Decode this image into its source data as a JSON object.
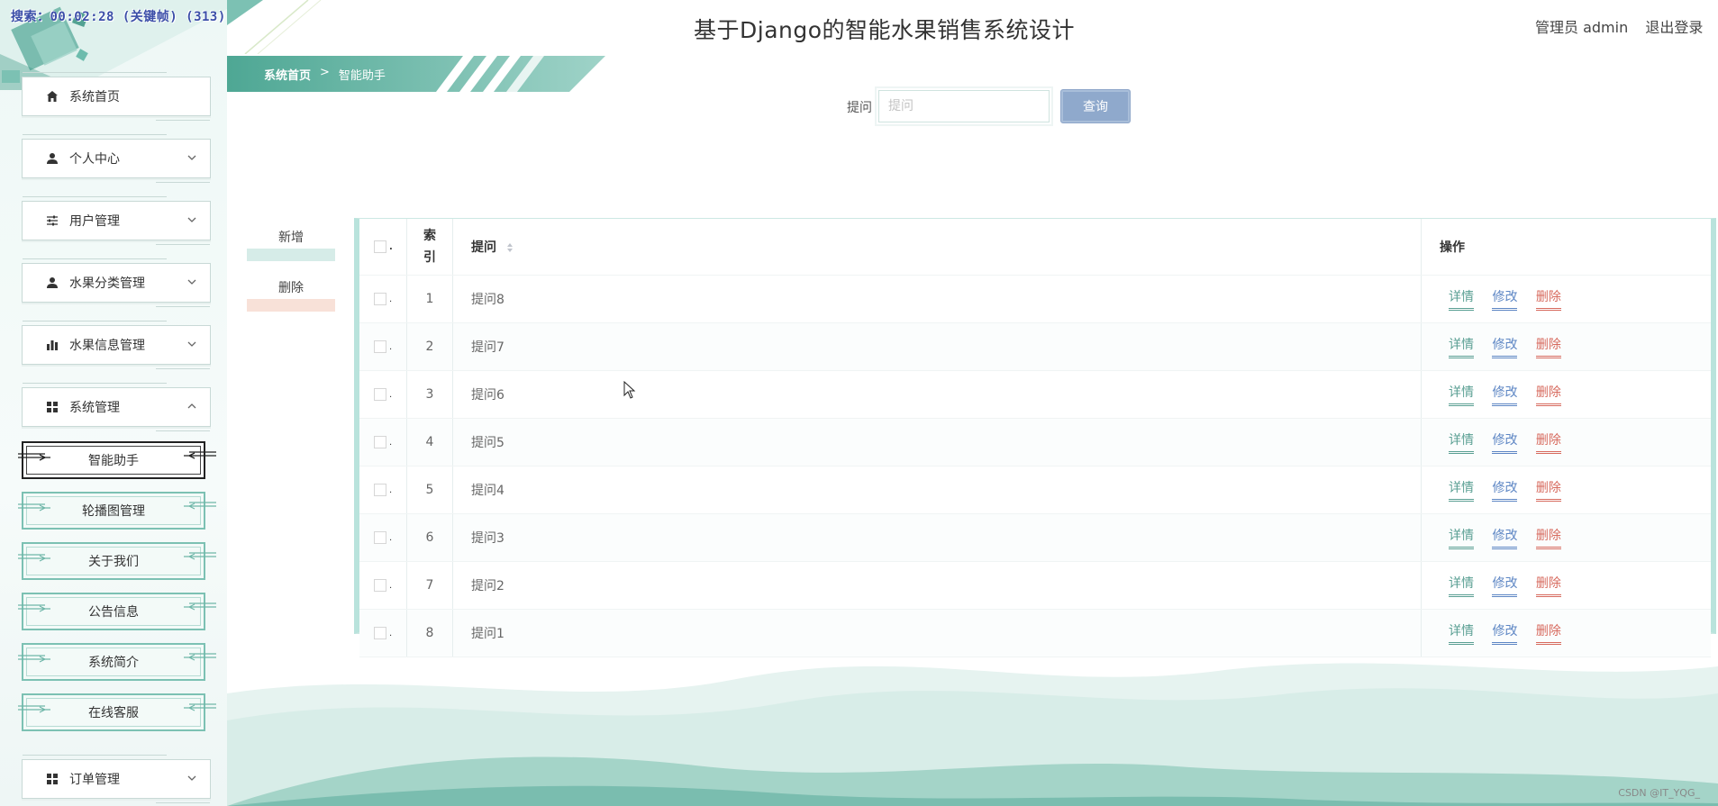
{
  "watermark": "搜索：00:02:28 (关键帧) (313)",
  "header": {
    "title": "基于Django的智能水果销售系统设计",
    "role": "管理员 admin",
    "logout": "退出登录"
  },
  "sidebar": {
    "items": [
      {
        "label": "系统首页",
        "icon": "home-icon"
      },
      {
        "label": "个人中心",
        "icon": "user-icon"
      },
      {
        "label": "用户管理",
        "icon": "sliders-icon"
      },
      {
        "label": "水果分类管理",
        "icon": "user-icon"
      },
      {
        "label": "水果信息管理",
        "icon": "bar-chart-icon"
      },
      {
        "label": "系统管理",
        "icon": "grid-icon"
      }
    ],
    "subitems": [
      {
        "label": "智能助手",
        "active": true
      },
      {
        "label": "轮播图管理"
      },
      {
        "label": "关于我们"
      },
      {
        "label": "公告信息"
      },
      {
        "label": "系统简介"
      },
      {
        "label": "在线客服"
      }
    ],
    "order": {
      "label": "订单管理",
      "icon": "grid-icon"
    }
  },
  "breadcrumb": {
    "home": "系统首页",
    "separator": ">",
    "current": "智能助手"
  },
  "search": {
    "label": "提问",
    "placeholder": "提问",
    "button": "查询"
  },
  "actions": {
    "add": "新增",
    "delete": "删除"
  },
  "table": {
    "headers": {
      "index": "索引",
      "question": "提问",
      "ops": "操作"
    },
    "rows": [
      {
        "index": "1",
        "question": "提问8"
      },
      {
        "index": "2",
        "question": "提问7"
      },
      {
        "index": "3",
        "question": "提问6"
      },
      {
        "index": "4",
        "question": "提问5"
      },
      {
        "index": "5",
        "question": "提问4"
      },
      {
        "index": "6",
        "question": "提问3"
      },
      {
        "index": "7",
        "question": "提问2"
      },
      {
        "index": "8",
        "question": "提问1"
      }
    ],
    "op_labels": {
      "detail": "详情",
      "edit": "修改",
      "delete": "删除"
    }
  },
  "credit": "CSDN @IT_YQG_",
  "colors": {
    "accent": "#5fae9f",
    "sidebar_bg": "#eef8f6",
    "query_btn": "#8fa9cc",
    "delete": "#d76a5e",
    "edit": "#5d86c4"
  }
}
